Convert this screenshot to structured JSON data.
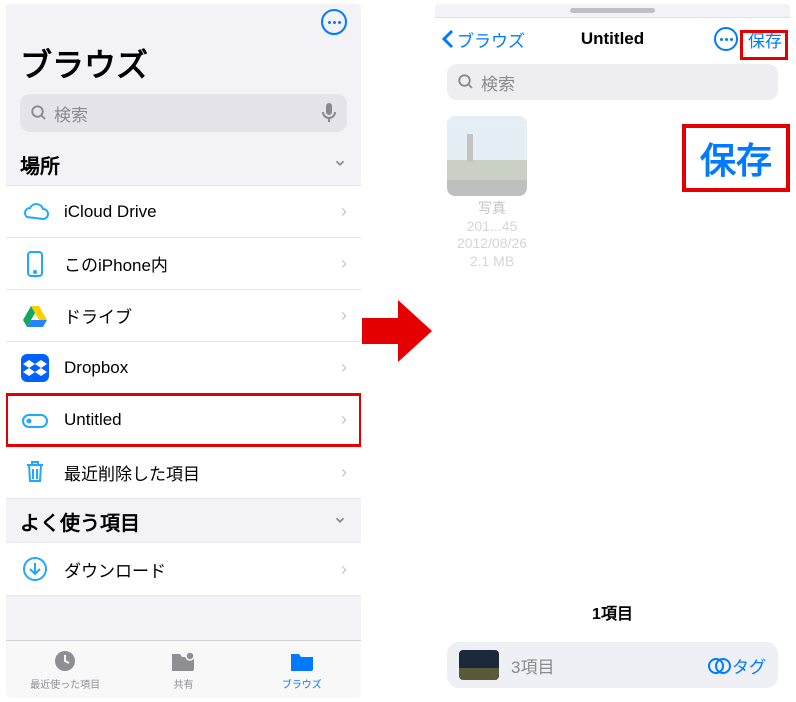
{
  "left": {
    "title": "ブラウズ",
    "search_placeholder": "検索",
    "section_locations": "場所",
    "section_favorites": "よく使う項目",
    "locations": [
      {
        "label": "iCloud Drive",
        "icon": "icloud"
      },
      {
        "label": "このiPhone内",
        "icon": "iphone"
      },
      {
        "label": "ドライブ",
        "icon": "gdrive"
      },
      {
        "label": "Dropbox",
        "icon": "dropbox"
      },
      {
        "label": "Untitled",
        "icon": "disk",
        "highlight": true
      },
      {
        "label": "最近削除した項目",
        "icon": "trash"
      }
    ],
    "favorites": [
      {
        "label": "ダウンロード",
        "icon": "download"
      }
    ],
    "tabs": {
      "recents": "最近使った項目",
      "shared": "共有",
      "browse": "ブラウズ"
    }
  },
  "right": {
    "back_label": "ブラウズ",
    "title": "Untitled",
    "save_label": "保存",
    "search_placeholder": "検索",
    "file": {
      "name1": "写真",
      "name2": "201...45",
      "date": "2012/08/26",
      "size": "2.1 MB"
    },
    "item_count": "1項目",
    "tray_count": "3項目",
    "tag_label": "タグ"
  },
  "callout": "保存"
}
